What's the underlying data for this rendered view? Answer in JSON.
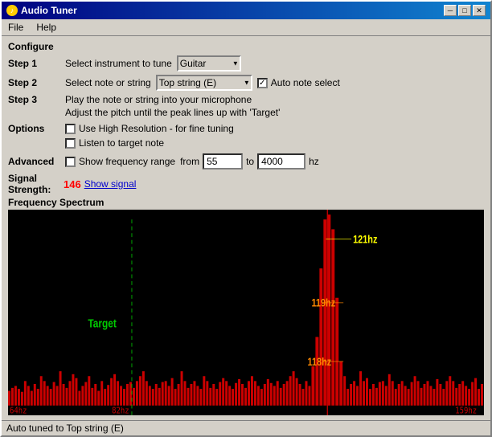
{
  "window": {
    "title": "Audio Tuner",
    "min_btn": "─",
    "max_btn": "□",
    "close_btn": "✕"
  },
  "menu": {
    "file_label": "File",
    "help_label": "Help"
  },
  "configure": {
    "section_label": "Configure",
    "step1_label": "Step 1",
    "step1_text": "Select instrument to tune",
    "instrument_value": "Guitar",
    "step2_label": "Step 2",
    "step2_text": "Select note or string",
    "note_value": "Top string (E)",
    "auto_note_label": "Auto note select",
    "step3_label": "Step 3",
    "step3_text": "Play the note or string into your microphone",
    "step3_hint": "Adjust the pitch until the peak lines up with 'Target'",
    "options_label": "Options",
    "option1_label": "Use High Resolution - for fine tuning",
    "option2_label": "Listen to target note",
    "advanced_label": "Advanced",
    "show_freq_label": "Show frequency range",
    "freq_from_label": "from",
    "freq_from_value": "55",
    "freq_to_label": "to",
    "freq_to_value": "4000",
    "freq_unit": "hz"
  },
  "signal": {
    "label": "Signal Strength:",
    "value": "146",
    "show_link": "Show signal"
  },
  "spectrum": {
    "label": "Frequency Spectrum",
    "target_label": "Target",
    "hz121_label": "121hz",
    "hz119_label": "119hz",
    "hz118_label": "118hz",
    "freq_low": "64hz",
    "freq_mid": "82hz",
    "freq_high": "159hz"
  },
  "status": {
    "text": "Auto tuned to Top string (E)"
  },
  "colors": {
    "accent_red": "#ff0000",
    "accent_yellow": "#ffff00",
    "accent_orange": "#ff8800",
    "accent_green": "#00cc00",
    "spectrum_bg": "#000000"
  }
}
